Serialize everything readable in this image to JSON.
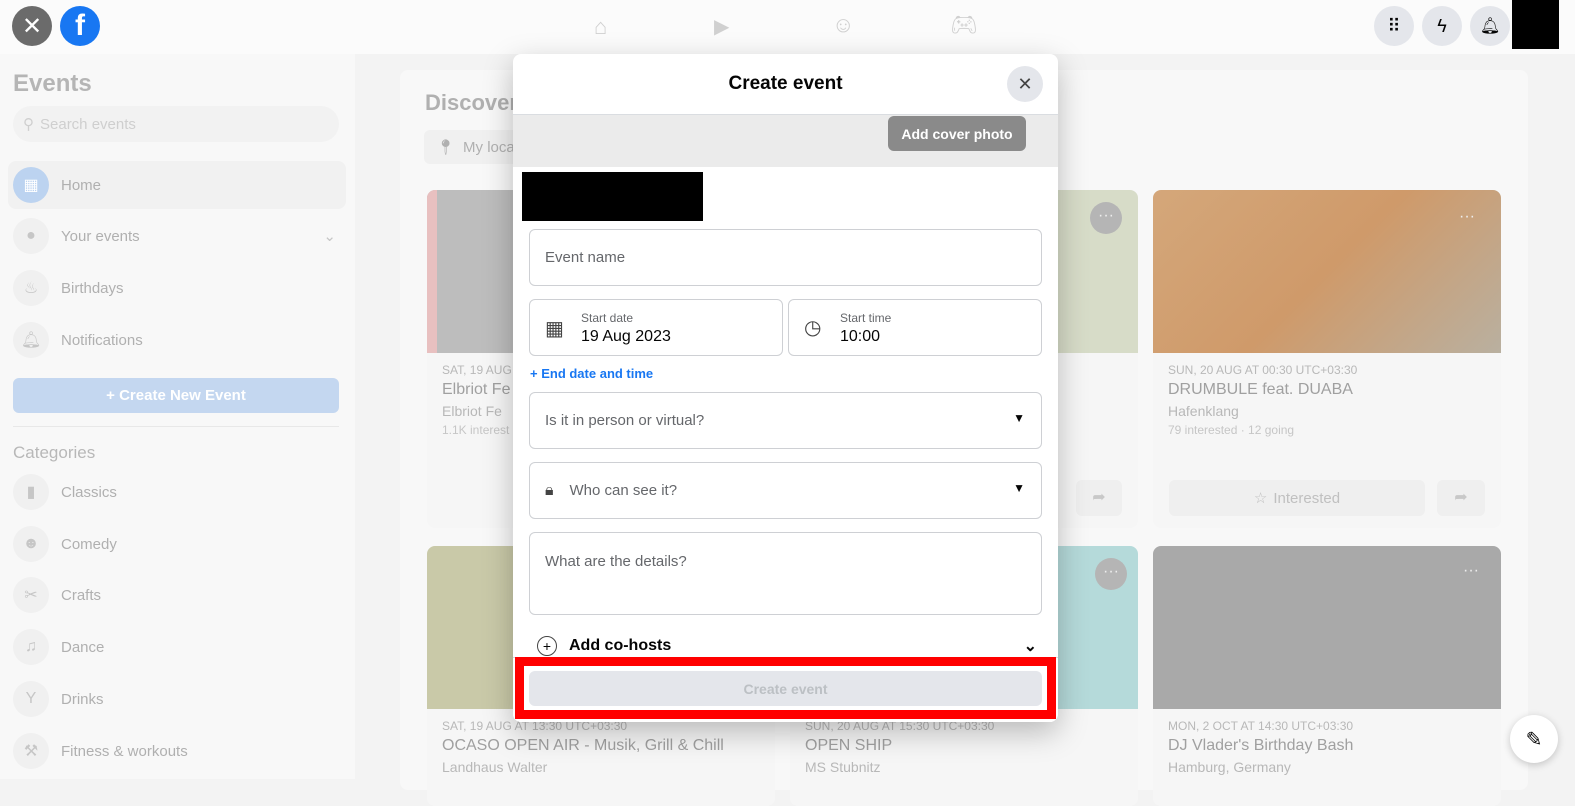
{
  "topbar": {
    "icons": [
      "close-icon",
      "facebook-logo",
      "home-icon",
      "watch-icon",
      "groups-icon",
      "gaming-icon",
      "menu-grid-icon",
      "messenger-icon",
      "notifications-icon"
    ]
  },
  "sidebar": {
    "title": "Events",
    "search_placeholder": "Search events",
    "items": [
      {
        "label": "Home",
        "icon": "calendar-icon"
      },
      {
        "label": "Your events",
        "icon": "person-icon"
      },
      {
        "label": "Birthdays",
        "icon": "cake-icon"
      },
      {
        "label": "Notifications",
        "icon": "bell-icon"
      }
    ],
    "create_button": "+ Create New Event",
    "categories_title": "Categories",
    "categories": [
      {
        "label": "Classics"
      },
      {
        "label": "Comedy"
      },
      {
        "label": "Crafts"
      },
      {
        "label": "Dance"
      },
      {
        "label": "Drinks"
      },
      {
        "label": "Fitness & workouts"
      }
    ]
  },
  "main": {
    "title": "Discover",
    "location": "My location",
    "cards": [
      {
        "date": "SAT, 19 AUG",
        "title": "Elbriot Fe",
        "sub": "Elbriot Fe",
        "count": "1.1K interest"
      },
      {
        "date": "SUN, 20 AUG AT 00:30 UTC+03:30",
        "title": "DRUMBULE feat. DUABA",
        "sub": "Hafenklang",
        "count": "79 interested · 12 going",
        "interested": "Interested"
      },
      {
        "date": "SAT, 19 AUG AT 13:30 UTC+03:30",
        "title": "OCASO OPEN AIR - Musik, Grill & Chill",
        "sub": "Landhaus Walter"
      },
      {
        "date": "SUN, 20 AUG AT 15:30 UTC+03:30",
        "title": "OPEN SHIP",
        "sub": "MS Stubnitz"
      },
      {
        "date": "MON, 2 OCT AT 14:30 UTC+03:30",
        "title": "DJ Vlader's Birthday Bash",
        "sub": "Hamburg, Germany"
      }
    ]
  },
  "modal": {
    "title": "Create event",
    "add_cover": "Add cover photo",
    "event_name_placeholder": "Event name",
    "start_date_label": "Start date",
    "start_date": "19 Aug 2023",
    "start_time_label": "Start time",
    "start_time": "10:00",
    "end_link": "+ End date and time",
    "in_person": "Is it in person or virtual?",
    "privacy": "Who can see it?",
    "details_placeholder": "What are the details?",
    "cohosts": "Add co-hosts",
    "submit": "Create event"
  },
  "colors": {
    "highlight": "#ff0000",
    "brand": "#1877f2"
  }
}
